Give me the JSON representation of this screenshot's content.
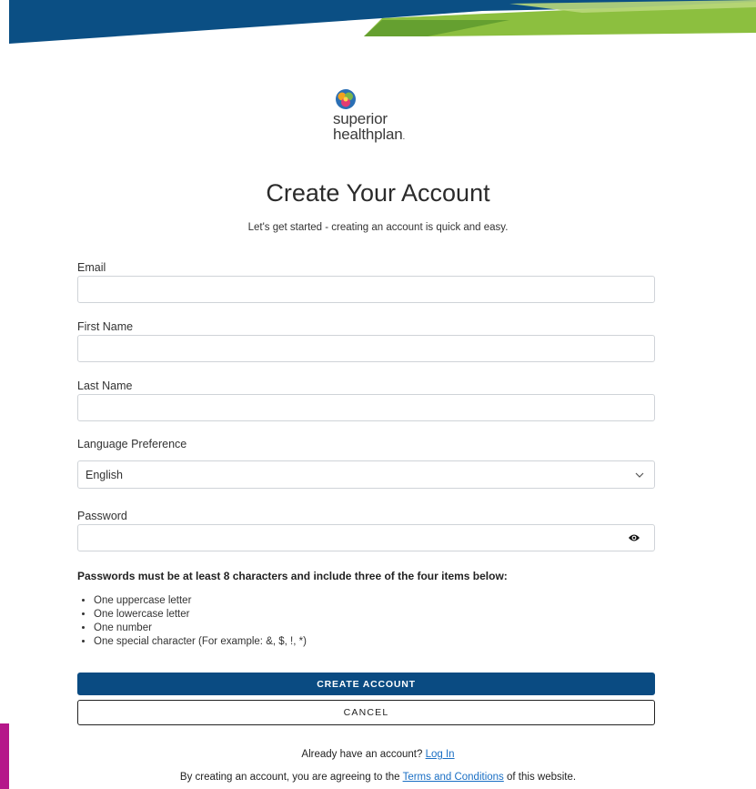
{
  "brand": {
    "logo_line1": "superior",
    "logo_line2": "healthplan",
    "logo_dot": ".",
    "header_dark": "#0b4f84",
    "header_green": "#8cbf3f",
    "accent_magenta": "#b5178a"
  },
  "page": {
    "title": "Create Your Account",
    "subtitle": "Let's get started - creating an account is quick and easy."
  },
  "form": {
    "email": {
      "label": "Email",
      "value": "",
      "placeholder": ""
    },
    "first_name": {
      "label": "First Name",
      "value": "",
      "placeholder": ""
    },
    "last_name": {
      "label": "Last Name",
      "value": "",
      "placeholder": ""
    },
    "language": {
      "label": "Language Preference",
      "selected": "English",
      "icon": "chevron-down-icon"
    },
    "password": {
      "label": "Password",
      "value": "",
      "placeholder": "",
      "icon": "eye-icon"
    }
  },
  "password_rules": {
    "title": "Passwords must be at least 8 characters and include three of the four items below:",
    "items": [
      "One uppercase letter",
      "One lowercase letter",
      "One number",
      "One special character (For example: &, $, !, *)"
    ]
  },
  "actions": {
    "create_label": "CREATE ACCOUNT",
    "cancel_label": "CANCEL",
    "primary_color": "#0a4b82"
  },
  "footer": {
    "login_prompt": "Already have an account?",
    "login_link": "Log In",
    "terms_prefix": "By creating an account, you are agreeing to the",
    "terms_link": "Terms and Conditions",
    "terms_suffix": "of this website."
  }
}
